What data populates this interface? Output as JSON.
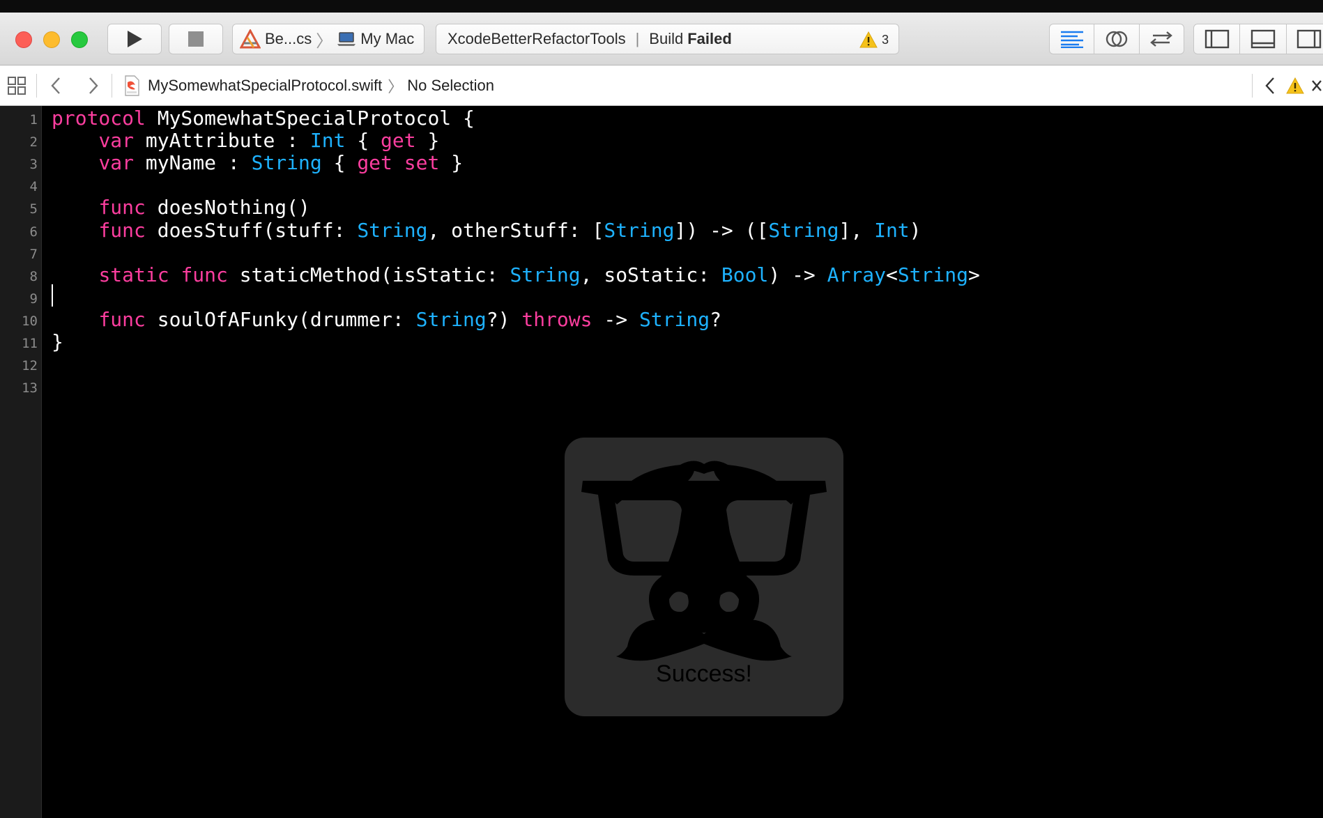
{
  "toolbar": {
    "scheme_name": "Be...cs",
    "destination": "My Mac",
    "project": "XcodeBetterRefactorTools",
    "build_label": "Build",
    "build_status": "Failed",
    "warning_count": "3"
  },
  "jumpbar": {
    "file_name": "MySomewhatSpecialProtocol.swift",
    "selection": "No Selection"
  },
  "editor": {
    "line_numbers": [
      "1",
      "2",
      "3",
      "4",
      "5",
      "6",
      "7",
      "8",
      "9",
      "10",
      "11",
      "12",
      "13"
    ],
    "lines": [
      [
        {
          "t": "protocol",
          "c": "kw"
        },
        {
          "t": " MySomewhatSpecialProtocol {",
          "c": ""
        }
      ],
      [
        {
          "t": "    ",
          "c": ""
        },
        {
          "t": "var",
          "c": "kw"
        },
        {
          "t": " myAttribute : ",
          "c": ""
        },
        {
          "t": "Int",
          "c": "ty"
        },
        {
          "t": " { ",
          "c": ""
        },
        {
          "t": "get",
          "c": "kw"
        },
        {
          "t": " }",
          "c": ""
        }
      ],
      [
        {
          "t": "    ",
          "c": ""
        },
        {
          "t": "var",
          "c": "kw"
        },
        {
          "t": " myName : ",
          "c": ""
        },
        {
          "t": "String",
          "c": "ty"
        },
        {
          "t": " { ",
          "c": ""
        },
        {
          "t": "get",
          "c": "kw"
        },
        {
          "t": " ",
          "c": ""
        },
        {
          "t": "set",
          "c": "kw"
        },
        {
          "t": " }",
          "c": ""
        }
      ],
      [],
      [
        {
          "t": "    ",
          "c": ""
        },
        {
          "t": "func",
          "c": "kw"
        },
        {
          "t": " doesNothing()",
          "c": ""
        }
      ],
      [
        {
          "t": "    ",
          "c": ""
        },
        {
          "t": "func",
          "c": "kw"
        },
        {
          "t": " doesStuff(stuff: ",
          "c": ""
        },
        {
          "t": "String",
          "c": "ty"
        },
        {
          "t": ", otherStuff: [",
          "c": ""
        },
        {
          "t": "String",
          "c": "ty"
        },
        {
          "t": "]) -> ([",
          "c": ""
        },
        {
          "t": "String",
          "c": "ty"
        },
        {
          "t": "], ",
          "c": ""
        },
        {
          "t": "Int",
          "c": "ty"
        },
        {
          "t": ")",
          "c": ""
        }
      ],
      [],
      [
        {
          "t": "    ",
          "c": ""
        },
        {
          "t": "static",
          "c": "kw"
        },
        {
          "t": " ",
          "c": ""
        },
        {
          "t": "func",
          "c": "kw"
        },
        {
          "t": " staticMethod(isStatic: ",
          "c": ""
        },
        {
          "t": "String",
          "c": "ty"
        },
        {
          "t": ", soStatic: ",
          "c": ""
        },
        {
          "t": "Bool",
          "c": "ty"
        },
        {
          "t": ") -> ",
          "c": ""
        },
        {
          "t": "Array",
          "c": "ty"
        },
        {
          "t": "<",
          "c": ""
        },
        {
          "t": "String",
          "c": "ty"
        },
        {
          "t": ">",
          "c": ""
        }
      ],
      [],
      [
        {
          "t": "    ",
          "c": ""
        },
        {
          "t": "func",
          "c": "kw"
        },
        {
          "t": " soulOfAFunky(drummer: ",
          "c": ""
        },
        {
          "t": "String",
          "c": "ty"
        },
        {
          "t": "?) ",
          "c": ""
        },
        {
          "t": "throws",
          "c": "kw"
        },
        {
          "t": " -> ",
          "c": ""
        },
        {
          "t": "String",
          "c": "ty"
        },
        {
          "t": "?",
          "c": ""
        }
      ],
      [
        {
          "t": "}",
          "c": ""
        }
      ],
      [],
      []
    ]
  },
  "hud": {
    "message": "Success!"
  },
  "colors": {
    "keyword": "#fc3e9f",
    "type": "#1eb2ff",
    "editor_background": "#000000"
  }
}
